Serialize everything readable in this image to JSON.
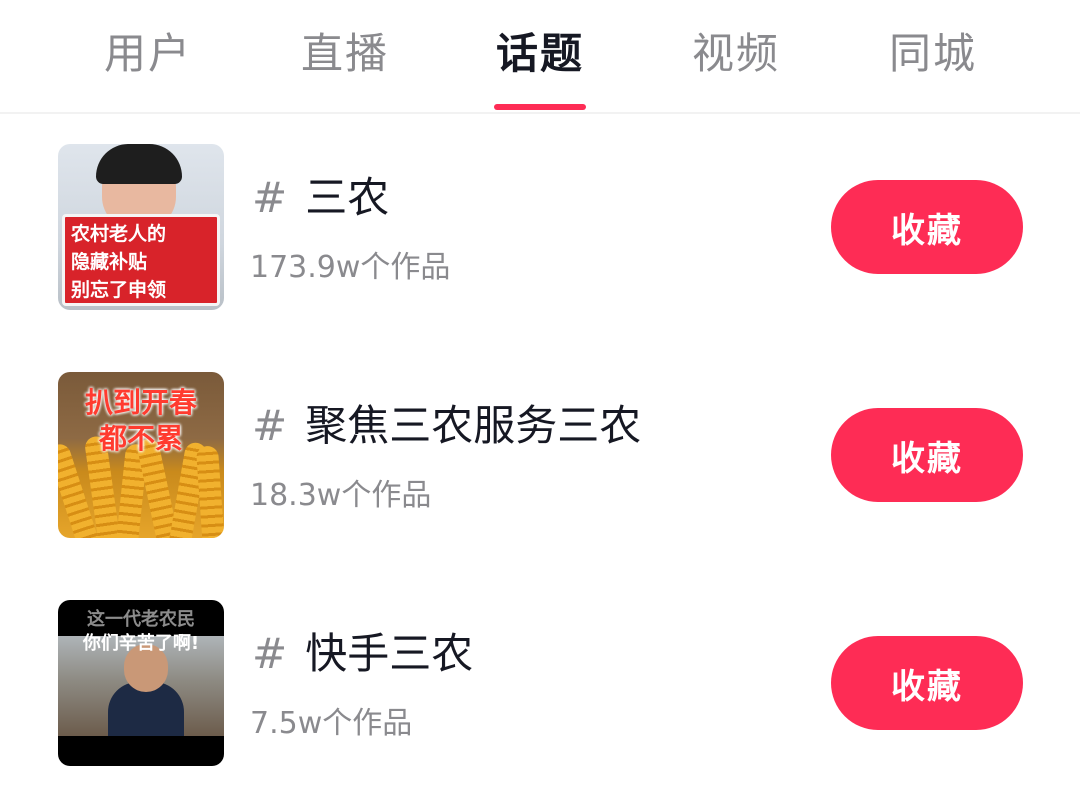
{
  "tabs": [
    {
      "label": "用户",
      "active": false
    },
    {
      "label": "直播",
      "active": false
    },
    {
      "label": "话题",
      "active": true
    },
    {
      "label": "视频",
      "active": false
    },
    {
      "label": "同城",
      "active": false
    }
  ],
  "accent_color": "#fe2c55",
  "topics": [
    {
      "hash": "#",
      "name": "三农",
      "count": "173.9w个作品",
      "button": "收藏",
      "thumb_caption": [
        "农村老人的",
        "隐藏补贴",
        "别忘了申领"
      ]
    },
    {
      "hash": "#",
      "name": "聚焦三农服务三农",
      "count": "18.3w个作品",
      "button": "收藏",
      "thumb_caption": [
        "扒到开春",
        "都不累"
      ]
    },
    {
      "hash": "#",
      "name": "快手三农",
      "count": "7.5w个作品",
      "button": "收藏",
      "thumb_caption": [
        "这一代老农民",
        "你们辛苦了啊!"
      ]
    }
  ]
}
